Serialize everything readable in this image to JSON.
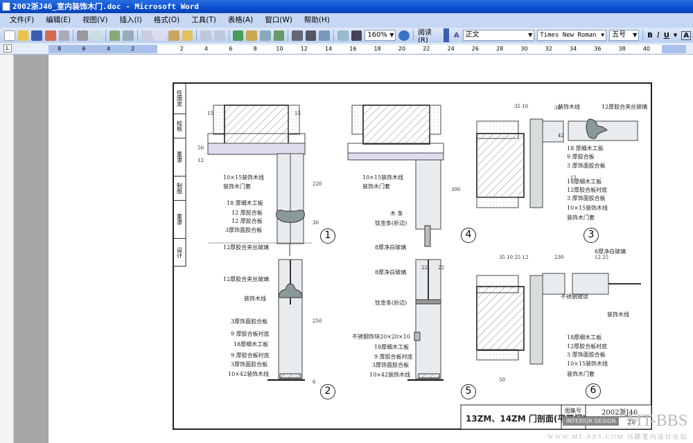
{
  "window": {
    "title": "2002浙J46_室内装饰木门.doc - Microsoft Word"
  },
  "menu": [
    "文件(F)",
    "编辑(E)",
    "视图(V)",
    "插入(I)",
    "格式(O)",
    "工具(T)",
    "表格(A)",
    "窗口(W)",
    "帮助(H)"
  ],
  "toolbar": {
    "zoom": "160%",
    "read": "阅读(R)",
    "style": "正文",
    "font": "Times New Roman",
    "size": "五号",
    "bold": "B",
    "italic": "I",
    "underline": "U",
    "charborder": "A"
  },
  "ruler": {
    "left": [
      "8",
      "6",
      "4",
      "2"
    ],
    "right": [
      "2",
      "4",
      "6",
      "8",
      "10",
      "12",
      "14",
      "16",
      "18",
      "20",
      "22",
      "24",
      "26",
      "28",
      "30",
      "32",
      "34",
      "36",
      "38",
      "40"
    ]
  },
  "drawing": {
    "strip": [
      "任国龙",
      "校核",
      "董渗",
      "制图",
      "董渗",
      "设计"
    ],
    "labels": [
      "10×15装饰木线",
      "装饰木门套",
      "18 厚细木工板",
      "12 厚胶合板",
      "12 厚胶合板",
      "3厚饰面胶合板",
      "12厚胶合夹丝玻璃",
      "10×15装饰木线",
      "装饰木门套",
      "木 条",
      "钛金条(折边)",
      "8厚净白玻璃",
      "装饰木线",
      "12厚胶合夹丝玻璃",
      "18 厚细木工板",
      "9 厚胶合板",
      "3 厚饰面胶合板",
      "18厚细木工板",
      "12厚胶合板衬底",
      "3 厚饰面胶合板",
      "10×15装饰木线",
      "装饰木门套",
      "12厚胶合夹丝玻璃",
      "装饰木线",
      "3厚饰面胶合板",
      "9 厚胶合板衬底",
      "18厚细木工板",
      "9 厚胶合板衬底",
      "3厚饰面胶合板",
      "10×42装饰木线",
      "8厚净白玻璃",
      "钛金条(折边)",
      "不锈钢饰块20×20×10",
      "18厚细木工板",
      "9 厚胶合板衬底",
      "3厚饰面胶合板",
      "10×42装饰木线",
      "8厚净白玻璃",
      "不锈钢镀钛",
      "装饰木线",
      "18厚细木工板",
      "12厚胶合板衬底",
      "3 厚饰面胶合板",
      "10×15装饰木线",
      "装饰木门套"
    ],
    "details": [
      "1",
      "4",
      "3",
      "2",
      "5",
      "6"
    ],
    "dims": [
      "15",
      "15",
      "50",
      "12",
      "220",
      "30",
      "300",
      "35 10",
      "30",
      "42",
      "12",
      "250",
      "22",
      "22",
      "35 10 25 12",
      "230",
      "12 25",
      "50",
      "6"
    ],
    "title_block": {
      "title": "13ZM、14ZM 门剖面(平开门)",
      "atlas_label": "图集号",
      "atlas_no": "2002浙J46",
      "page": "26"
    },
    "watermark": {
      "badge": "INTERIOR DESIGN",
      "logo": "MT-BBS",
      "url": "WWW.MT-BBS.COM  马蹄室内设计论坛"
    }
  }
}
